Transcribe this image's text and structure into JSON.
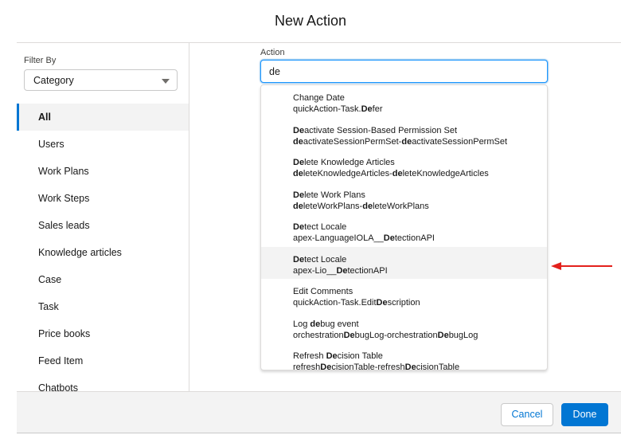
{
  "modal": {
    "title": "New Action"
  },
  "sidebar": {
    "filter_label": "Filter By",
    "filter_value": "Category",
    "items": [
      {
        "label": "All"
      },
      {
        "label": "Users"
      },
      {
        "label": "Work Plans"
      },
      {
        "label": "Work Steps"
      },
      {
        "label": "Sales leads"
      },
      {
        "label": "Knowledge articles"
      },
      {
        "label": "Case"
      },
      {
        "label": "Task"
      },
      {
        "label": "Price books"
      },
      {
        "label": "Feed Item"
      },
      {
        "label": "Chatbots"
      }
    ],
    "selected_index": 0
  },
  "action": {
    "label": "Action",
    "value": "de",
    "search_term": "de",
    "highlighted_index": 5,
    "options": [
      {
        "title": "Change Date",
        "name": "quickAction-Task.Defer"
      },
      {
        "title": "Deactivate Session-Based Permission Set",
        "name": "deactivateSessionPermSet-deactivateSessionPermSet"
      },
      {
        "title": "Delete Knowledge Articles",
        "name": "deleteKnowledgeArticles-deleteKnowledgeArticles"
      },
      {
        "title": "Delete Work Plans",
        "name": "deleteWorkPlans-deleteWorkPlans"
      },
      {
        "title": "Detect Locale",
        "name": "apex-LanguageIOLA__DetectionAPI"
      },
      {
        "title": "Detect Locale",
        "name": "apex-Lio__DetectionAPI"
      },
      {
        "title": "Edit Comments",
        "name": "quickAction-Task.EditDescription"
      },
      {
        "title": "Log debug event",
        "name": "orchestrationDebugLog-orchestrationDebugLog"
      },
      {
        "title": "Refresh Decision Table",
        "name": "refreshDecisionTable-refreshDecisionTable"
      }
    ]
  },
  "footer": {
    "cancel_label": "Cancel",
    "done_label": "Done"
  },
  "colors": {
    "brand": "#0176d3",
    "annotation_arrow": "#e3211c"
  },
  "icons": {
    "filter_caret": "chevron-down-icon",
    "annotation": "red-arrow-icon"
  }
}
